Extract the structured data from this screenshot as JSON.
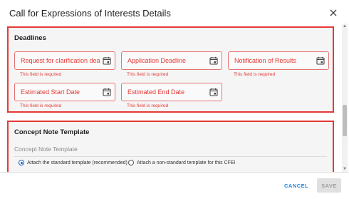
{
  "dialog": {
    "title": "Call for Expressions of Interests Details",
    "close_icon": "close-icon"
  },
  "deadlines": {
    "title": "Deadlines",
    "fields": [
      {
        "label": "Request for clarification dead...",
        "error": "This field is required",
        "icon": "calendar-icon"
      },
      {
        "label": "Application Deadline",
        "error": "This field is required",
        "icon": "calendar-icon"
      },
      {
        "label": "Notification of Results",
        "error": "This field is required",
        "icon": "calendar-icon"
      },
      {
        "label": "Estimated Start Date",
        "error": "This field is required",
        "icon": "calendar-icon"
      },
      {
        "label": "Estimated End Date",
        "error": "This field is required",
        "icon": "calendar-icon"
      }
    ]
  },
  "concept": {
    "title": "Concept Note Template",
    "sub_label": "Concept Note Template",
    "options": [
      {
        "label": "Attach the standard template (recommended)",
        "selected": true
      },
      {
        "label": "Attach a non-standard template for this CFEI",
        "selected": false
      }
    ]
  },
  "footer": {
    "cancel_label": "CANCEL",
    "save_label": "SAVE"
  },
  "colors": {
    "error": "#e53935",
    "accent": "#1e88e5",
    "section_bg": "#f5f5f5"
  }
}
